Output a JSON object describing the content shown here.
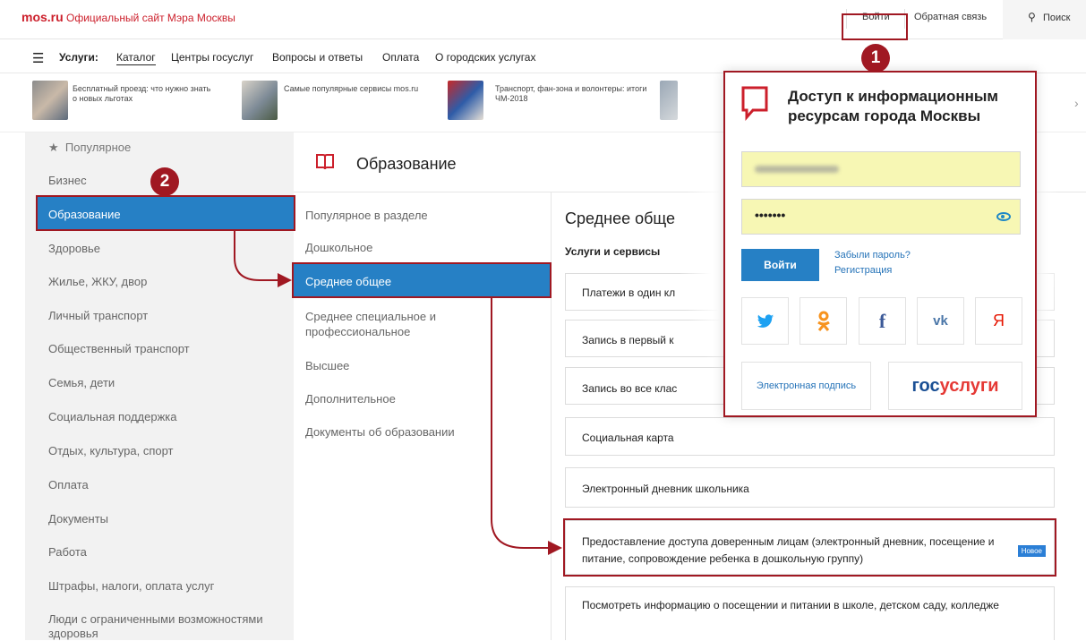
{
  "header": {
    "logo": "mos.ru",
    "site_title": "Официальный сайт Мэра Москвы",
    "login": "Войти",
    "feedback": "Обратная связь",
    "search": "Поиск"
  },
  "nav": {
    "services_label": "Услуги:",
    "items": [
      "Каталог",
      "Центры госуслуг",
      "Вопросы и ответы",
      "Оплата",
      "О городских услугах"
    ]
  },
  "news": [
    {
      "text": "Бесплатный проезд: что нужно знать о новых льготах"
    },
    {
      "text": "Самые популярные сервисы mos.ru"
    },
    {
      "text": "Транспорт, фан-зона и волонтеры: итоги ЧМ-2018"
    }
  ],
  "categories": {
    "popular": "Популярное",
    "items": [
      "Бизнес",
      "Образование",
      "Здоровье",
      "Жилье, ЖКУ, двор",
      "Личный транспорт",
      "Общественный транспорт",
      "Семья, дети",
      "Социальная поддержка",
      "Отдых, культура, спорт",
      "Оплата",
      "Документы",
      "Работа",
      "Штрафы, налоги, оплата услуг",
      "Люди с ограниченными возможностями здоровья"
    ]
  },
  "section": {
    "title": "Образование",
    "subs": [
      "Популярное в разделе",
      "Дошкольное",
      "Среднее общее",
      "Среднее специальное и профессиональное",
      "Высшее",
      "Дополнительное",
      "Документы об образовании"
    ]
  },
  "detail": {
    "title": "Среднее общее",
    "services_header": "Услуги и сервисы",
    "services": [
      "Платежи в один клик",
      "Запись в первый класс",
      "Запись во все классы",
      "Социальная карта",
      "Электронный дневник школьника",
      "Предоставление доступа доверенным лицам (электронный дневник, посещение и питание, сопровождение ребенка в дошкольную группу)",
      "Посмотреть информацию о посещении и питании в школе, детском саду, колледже"
    ],
    "badge_new": "Новое"
  },
  "visible_text": {
    "svc0": "Платежи в один кл",
    "svc1": "Запись в первый к",
    "svc2": "Запись во все клас",
    "svc3": "Социальная карта",
    "title": "Среднее обще"
  },
  "popup": {
    "title": "Доступ к информационным ресурсам города Москвы",
    "password_mask": "•••••••",
    "login_button": "Войти",
    "forgot": "Забыли пароль?",
    "register": "Регистрация",
    "socials": [
      {
        "name": "twitter",
        "glyph": "🐦",
        "color": "#1da1f2"
      },
      {
        "name": "odnoklassniki",
        "glyph": "ꝏ",
        "color": "#f7931e"
      },
      {
        "name": "facebook",
        "glyph": "f",
        "color": "#3b5998"
      },
      {
        "name": "vk",
        "glyph": "vk",
        "color": "#4a76a8"
      },
      {
        "name": "yandex",
        "glyph": "Я",
        "color": "#e61400"
      }
    ],
    "esign": "Электронная подпись",
    "gosuslugi_a": "гос",
    "gosuslugi_b": "услуги"
  },
  "annotations": {
    "step1": "1",
    "step2": "2"
  },
  "colors": {
    "brand_red": "#cc1f2b",
    "accent_blue": "#2680c5",
    "annotation": "#a01822"
  }
}
